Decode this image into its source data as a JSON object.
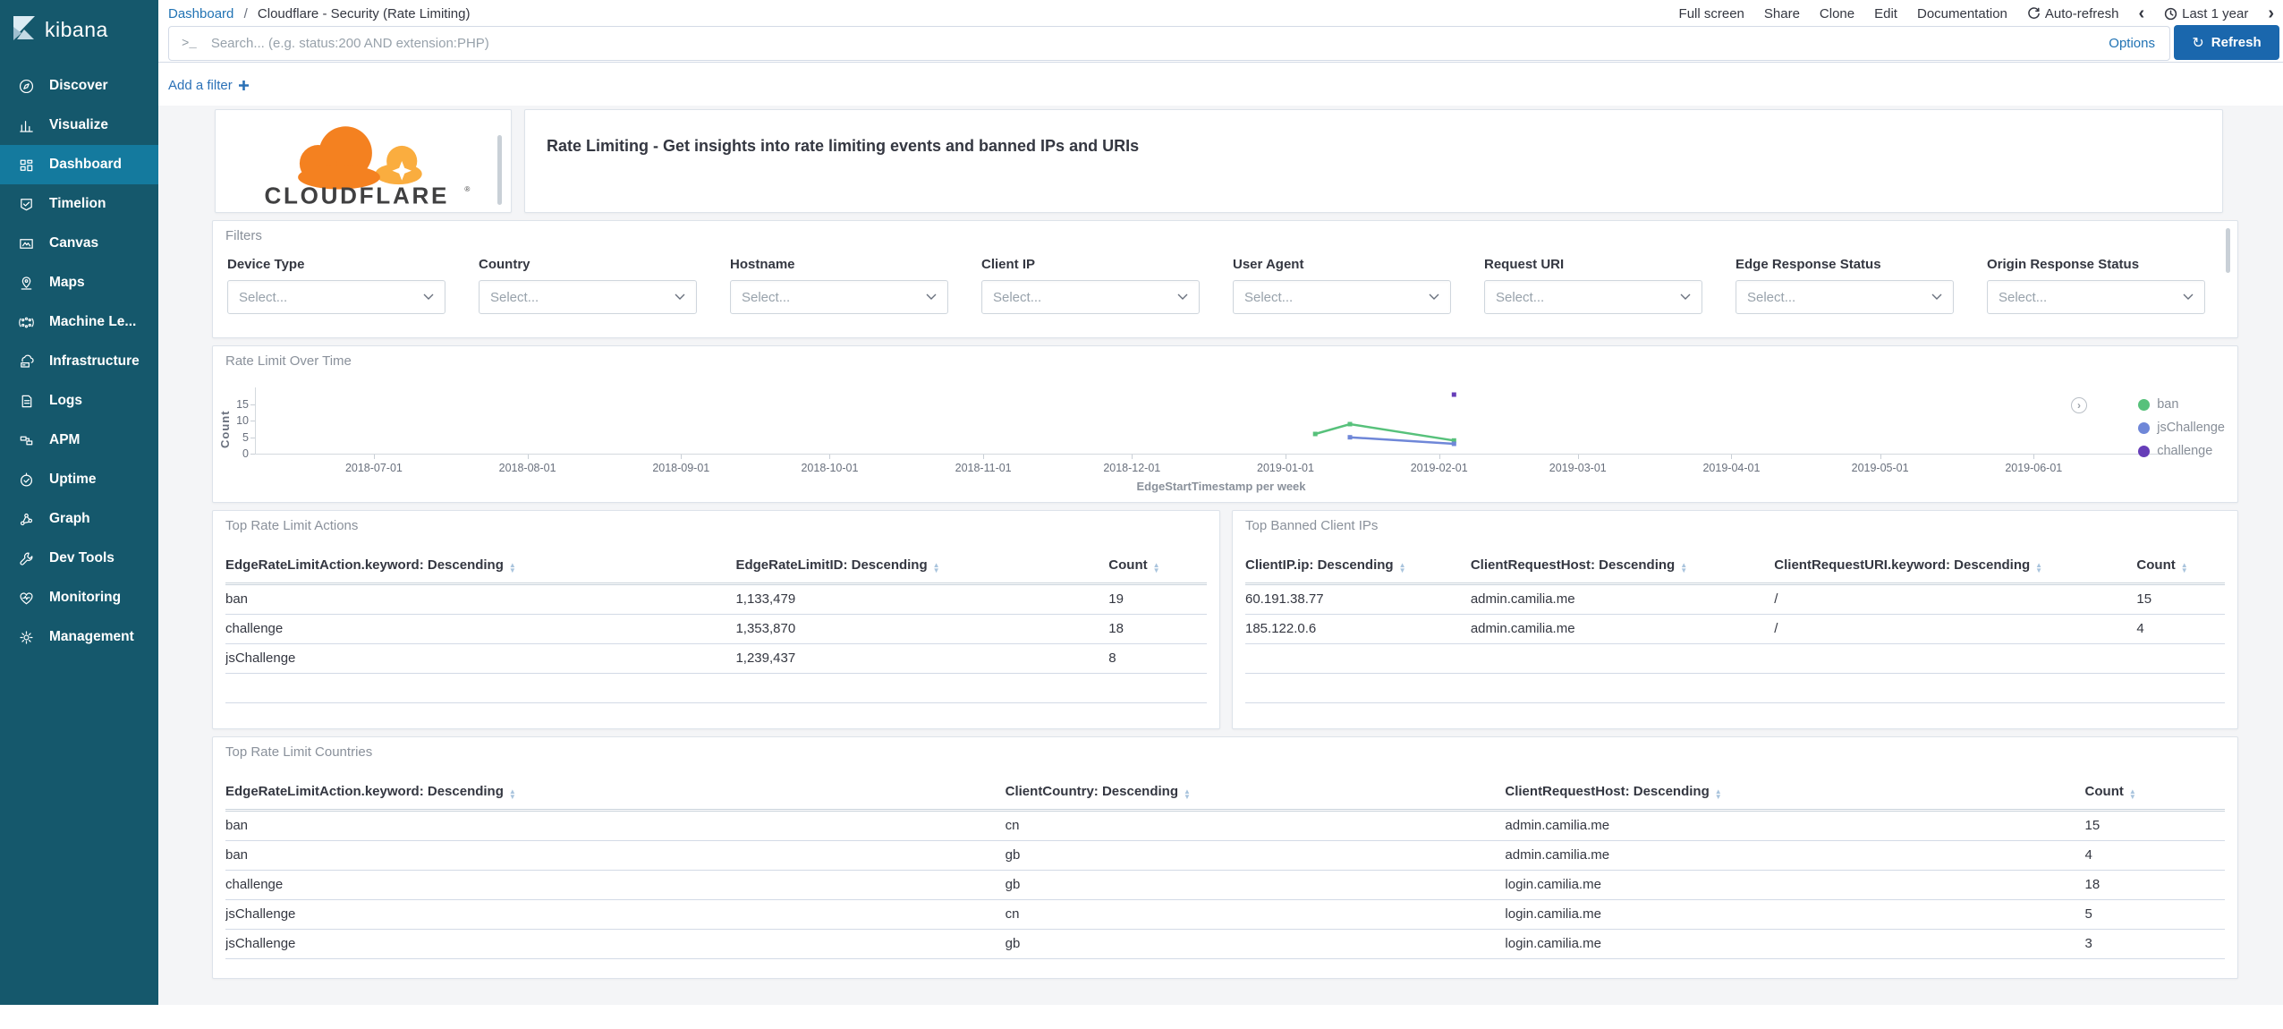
{
  "chrome": {
    "logo_text": "kibana",
    "logo_icon": "kibana-logo-icon",
    "breadcrumb": {
      "parent": "Dashboard",
      "separator": "/",
      "current": "Cloudflare - Security (Rate Limiting)"
    },
    "menu_items": [
      "Full screen",
      "Share",
      "Clone",
      "Edit",
      "Documentation"
    ],
    "auto_refresh_label": "Auto-refresh",
    "auto_refresh_icon": "refresh-cycle-icon",
    "time_prev_icon": "chevron-left-icon",
    "time_next_icon": "chevron-right-icon",
    "time_icon": "clock-icon",
    "time_label": "Last 1 year",
    "search_icon": "terminal-prompt-icon",
    "search_placeholder": "Search... (e.g. status:200 AND extension:PHP)",
    "options_label": "Options",
    "refresh_label": "Refresh",
    "refresh_icon": "refresh-icon",
    "add_filter_label": "Add a filter",
    "add_filter_icon": "plus-icon"
  },
  "sidebar": {
    "items": [
      {
        "label": "Discover",
        "icon": "compass-icon",
        "active": false
      },
      {
        "label": "Visualize",
        "icon": "bar-chart-icon",
        "active": false
      },
      {
        "label": "Dashboard",
        "icon": "dashboard-icon",
        "active": true
      },
      {
        "label": "Timelion",
        "icon": "timelion-icon",
        "active": false
      },
      {
        "label": "Canvas",
        "icon": "canvas-icon",
        "active": false
      },
      {
        "label": "Maps",
        "icon": "map-pin-icon",
        "active": false
      },
      {
        "label": "Machine Le...",
        "icon": "machine-learning-icon",
        "active": false
      },
      {
        "label": "Infrastructure",
        "icon": "infrastructure-icon",
        "active": false
      },
      {
        "label": "Logs",
        "icon": "logs-icon",
        "active": false
      },
      {
        "label": "APM",
        "icon": "apm-icon",
        "active": false
      },
      {
        "label": "Uptime",
        "icon": "uptime-icon",
        "active": false
      },
      {
        "label": "Graph",
        "icon": "graph-icon",
        "active": false
      },
      {
        "label": "Dev Tools",
        "icon": "dev-tools-icon",
        "active": false
      },
      {
        "label": "Monitoring",
        "icon": "heartbeat-icon",
        "active": false
      },
      {
        "label": "Management",
        "icon": "gear-icon",
        "active": false
      }
    ]
  },
  "panels": {
    "logo_panel": {
      "brand": "CLOUDFLARE",
      "registered_mark": "®",
      "logo_icon": "cloudflare-cloud-icon"
    },
    "banner": {
      "text": "Rate Limiting - Get insights into rate limiting events and banned IPs and URIs"
    },
    "filters": {
      "title": "Filters",
      "select_placeholder": "Select...",
      "fields": [
        {
          "label": "Device Type"
        },
        {
          "label": "Country"
        },
        {
          "label": "Hostname"
        },
        {
          "label": "Client IP"
        },
        {
          "label": "User Agent"
        },
        {
          "label": "Request URI"
        },
        {
          "label": "Edge Response Status"
        },
        {
          "label": "Origin Response Status"
        }
      ]
    },
    "chart_panel": {
      "title": "Rate Limit Over Time"
    },
    "actions_table": {
      "title": "Top Rate Limit Actions",
      "columns": [
        "EdgeRateLimitAction.keyword: Descending",
        "EdgeRateLimitID: Descending",
        "Count"
      ],
      "rows": [
        [
          "ban",
          "1,133,479",
          "19"
        ],
        [
          "challenge",
          "1,353,870",
          "18"
        ],
        [
          "jsChallenge",
          "1,239,437",
          "8"
        ]
      ]
    },
    "banned_ips_table": {
      "title": "Top Banned Client IPs",
      "columns": [
        "ClientIP.ip: Descending",
        "ClientRequestHost: Descending",
        "ClientRequestURI.keyword: Descending",
        "Count"
      ],
      "rows": [
        [
          "60.191.38.77",
          "admin.camilia.me",
          "/",
          "15"
        ],
        [
          "185.122.0.6",
          "admin.camilia.me",
          "/",
          "4"
        ]
      ]
    },
    "countries_table": {
      "title": "Top Rate Limit Countries",
      "columns": [
        "EdgeRateLimitAction.keyword: Descending",
        "ClientCountry: Descending",
        "ClientRequestHost: Descending",
        "Count"
      ],
      "rows": [
        [
          "ban",
          "cn",
          "admin.camilia.me",
          "15"
        ],
        [
          "ban",
          "gb",
          "admin.camilia.me",
          "4"
        ],
        [
          "challenge",
          "gb",
          "login.camilia.me",
          "18"
        ],
        [
          "jsChallenge",
          "cn",
          "login.camilia.me",
          "5"
        ],
        [
          "jsChallenge",
          "gb",
          "login.camilia.me",
          "3"
        ]
      ]
    }
  },
  "chart_data": {
    "type": "line",
    "title": "Rate Limit Over Time",
    "xlabel": "EdgeStartTimestamp per week",
    "ylabel": "Count",
    "x_domain": [
      "2018-06-07",
      "2019-07-02"
    ],
    "ylim": [
      0,
      20
    ],
    "y_ticks": [
      15,
      10,
      5,
      0
    ],
    "x_ticks": [
      "2018-07-01",
      "2018-08-01",
      "2018-09-01",
      "2018-10-01",
      "2018-11-01",
      "2018-12-01",
      "2019-01-01",
      "2019-02-01",
      "2019-03-01",
      "2019-04-01",
      "2019-05-01",
      "2019-06-01"
    ],
    "grid": false,
    "legend_position": "right",
    "legend_expand_icon": "chevron-right-circle-icon",
    "series": [
      {
        "name": "ban",
        "color": "#57c17b",
        "points": [
          [
            "2019-01-07",
            6
          ],
          [
            "2019-01-14",
            9
          ],
          [
            "2019-02-04",
            4
          ]
        ]
      },
      {
        "name": "jsChallenge",
        "color": "#6f87d8",
        "points": [
          [
            "2019-01-14",
            5
          ],
          [
            "2019-02-04",
            3
          ]
        ]
      },
      {
        "name": "challenge",
        "color": "#663db8",
        "points": [
          [
            "2019-02-04",
            18
          ]
        ]
      }
    ]
  },
  "colors": {
    "sidebar_bg": "#15586c",
    "sidebar_active_bg": "#147a9e",
    "link_blue": "#2173b4",
    "button_blue": "#1a67ad",
    "cloudflare_orange": "#f48120",
    "cloudflare_light_orange": "#faad3f",
    "panel_title_gray": "#8a919b"
  }
}
